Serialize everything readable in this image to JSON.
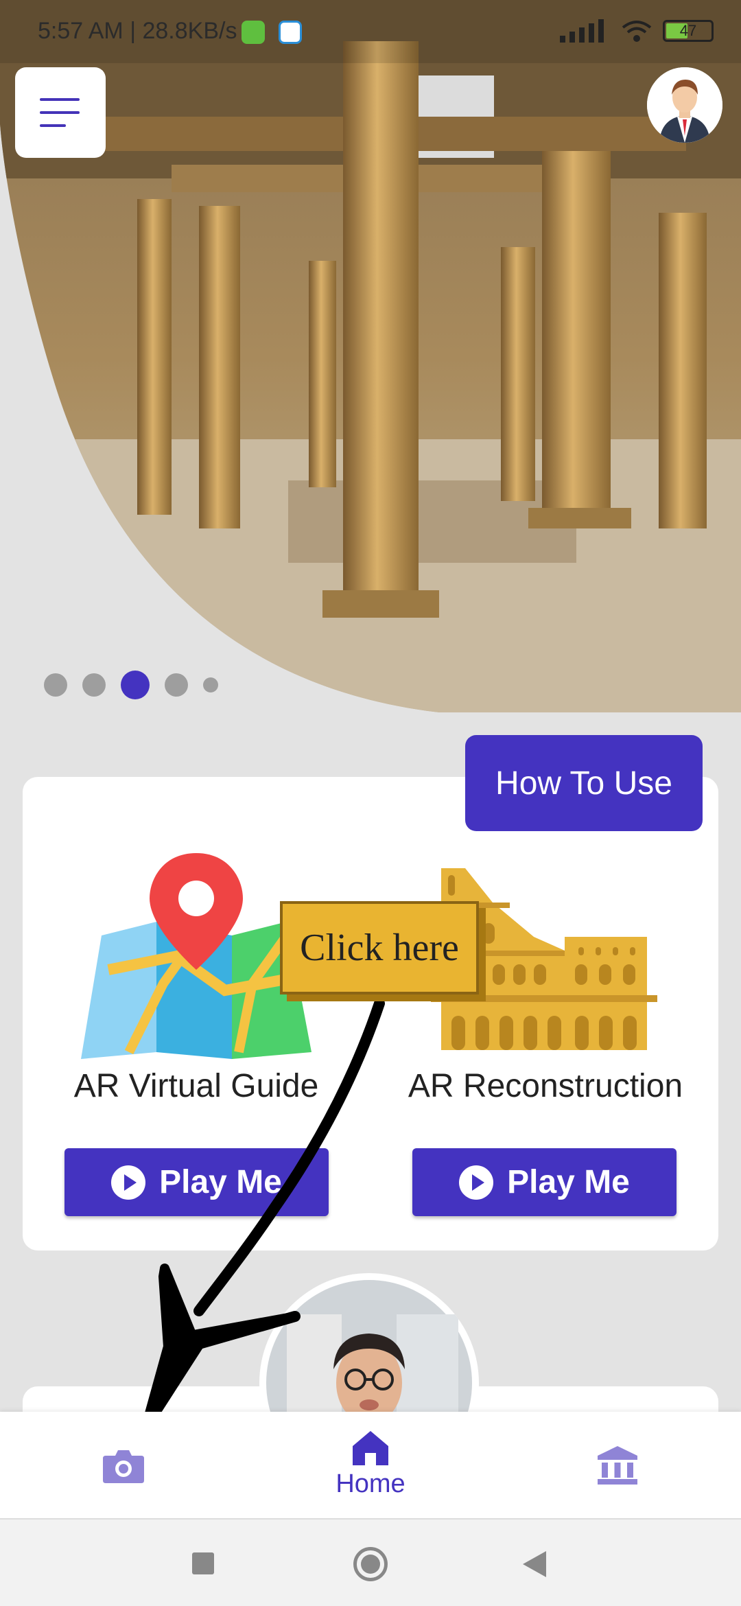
{
  "status_bar": {
    "time_speed": "5:57 AM | 28.8KB/s",
    "battery": "47"
  },
  "carousel": {
    "image": "ruins-colonnade-photo",
    "dots_total": 5,
    "active_index": 2
  },
  "how_to_use": {
    "label": "How To Use"
  },
  "features": [
    {
      "title": "AR Virtual Guide",
      "icon": "map-pin-icon",
      "button": "Play Me"
    },
    {
      "title": "AR Reconstruction",
      "icon": "colosseum-icon",
      "button": "Play Me"
    }
  ],
  "annotation": {
    "label": "Click here"
  },
  "bottom_nav": {
    "items": [
      {
        "icon": "camera-icon",
        "label": ""
      },
      {
        "icon": "home-icon",
        "label": "Home"
      },
      {
        "icon": "museum-icon",
        "label": ""
      }
    ]
  },
  "colors": {
    "accent": "#4433c0",
    "accent_light": "#8f84d6",
    "background": "#e3e3e3",
    "annotation_bg": "#e9b431"
  }
}
